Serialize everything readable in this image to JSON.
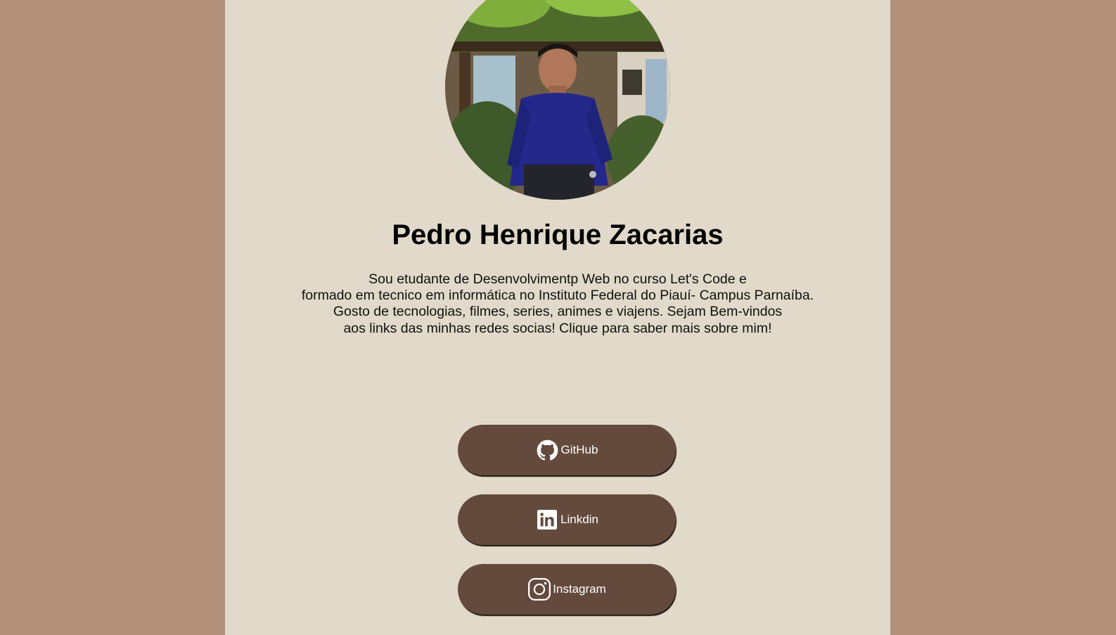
{
  "profile": {
    "name": "Pedro Henrique Zacarias",
    "bio_lines": [
      "Sou etudante de Desenvolvimentp Web no curso Let's Code e",
      "formado em tecnico em informática no Instituto Federal do Piauí- Campus Parnaíba.",
      "Gosto de tecnologias, filmes, series, animes e viajens. Sejam Bem-vindos",
      "aos links das minhas redes socias! Clique para saber mais sobre mim!"
    ]
  },
  "links": [
    {
      "label": "GitHub",
      "icon": "github-icon"
    },
    {
      "label": "Linkdin",
      "icon": "linkedin-icon"
    },
    {
      "label": "Instagram",
      "icon": "instagram-icon"
    }
  ],
  "colors": {
    "background": "#b39079",
    "panel": "#e1d9c9",
    "button": "#634a3c",
    "button_text": "#ffffff"
  }
}
